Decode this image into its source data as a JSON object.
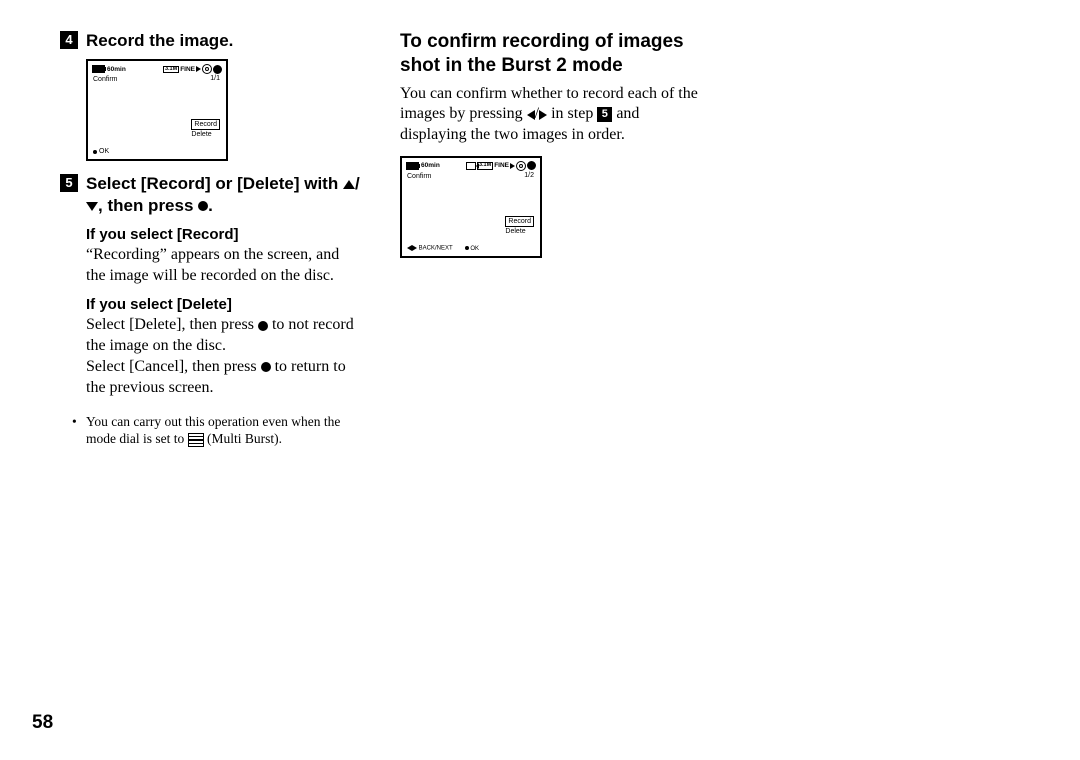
{
  "pageNumber": "58",
  "leftCol": {
    "step4": {
      "num": "4",
      "title": "Record the image."
    },
    "step5": {
      "num": "5",
      "title_a": "Select [Record] or [Delete] with ",
      "title_b": ", then press ",
      "title_c": "."
    },
    "ifRecord": {
      "heading": "If you select [Record]",
      "text": "“Recording” appears on the screen, and the image will be recorded on the disc."
    },
    "ifDelete": {
      "heading": "If you select [Delete]",
      "text_a": "Select [Delete], then press ",
      "text_b": " to not record the image on the disc.",
      "text_c": "Select [Cancel], then press ",
      "text_d": " to return to the previous screen."
    },
    "bullet_a": "You can carry out this operation even when the mode dial is set to ",
    "bullet_b": " (Multi Burst)."
  },
  "rightCol": {
    "title": "To confirm recording of images shot in the Burst 2 mode",
    "para_a": "You can confirm whether to record each of the images by pressing ",
    "para_b": " in step ",
    "para_num": "5",
    "para_c": " and displaying the two images in order."
  },
  "lcd1": {
    "battery": "60min",
    "mp": "3.1M",
    "fine": "FINE",
    "confirm": "Confirm",
    "counter": "1/1",
    "record": "Record",
    "delete": "Delete",
    "ok": "OK"
  },
  "lcd2": {
    "battery": "60min",
    "mp": "3.1M",
    "fine": "FINE",
    "confirm": "Confirm",
    "counter": "1/2",
    "record": "Record",
    "delete": "Delete",
    "backnext": "BACK/NEXT",
    "ok": "OK"
  }
}
